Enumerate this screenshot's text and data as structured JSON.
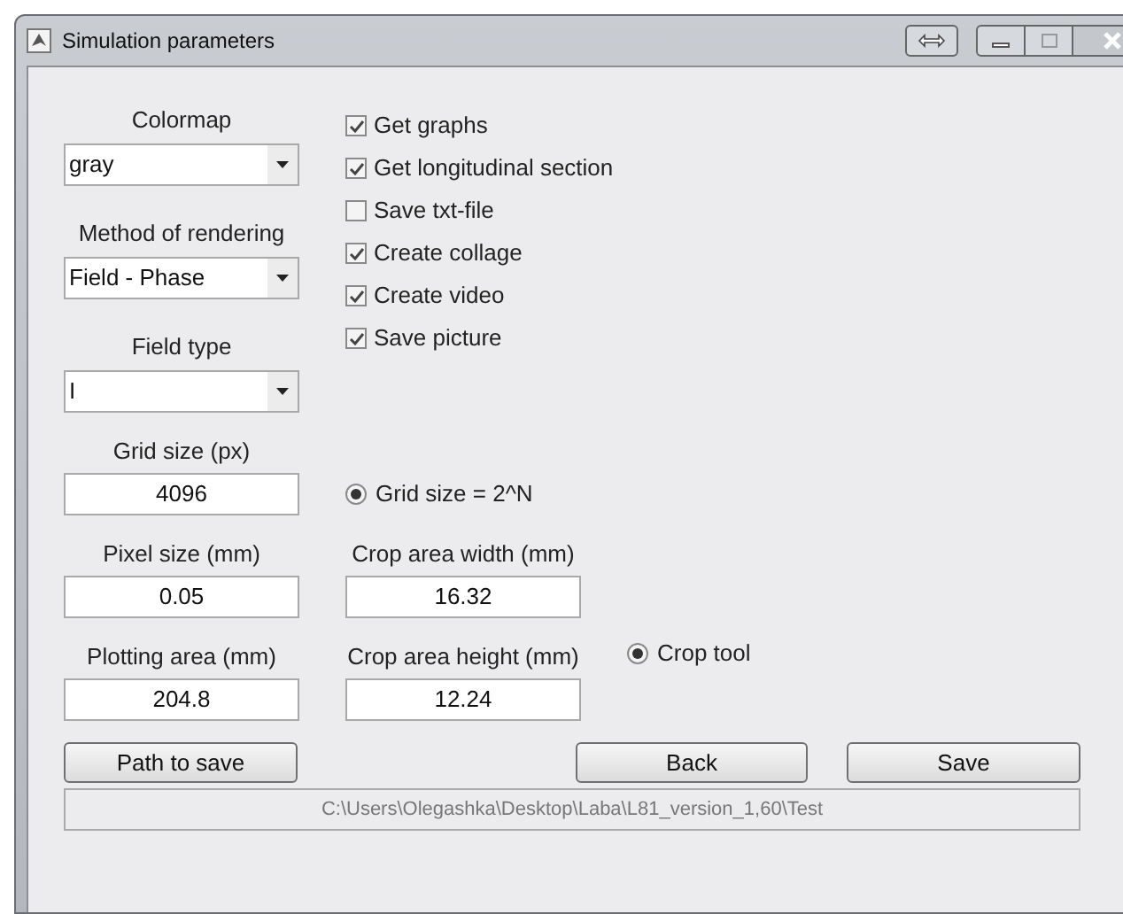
{
  "window": {
    "title": "Simulation parameters"
  },
  "dropdowns": [
    {
      "label": "Colormap",
      "value": "gray"
    },
    {
      "label": "Method of rendering",
      "value": "Field - Phase"
    },
    {
      "label": "Field type",
      "value": "I"
    }
  ],
  "checkboxes": [
    {
      "label": "Get graphs",
      "checked": true
    },
    {
      "label": "Get longitudinal section",
      "checked": true
    },
    {
      "label": "Save txt-file",
      "checked": false
    },
    {
      "label": "Create collage",
      "checked": true
    },
    {
      "label": "Create video",
      "checked": true
    },
    {
      "label": "Save picture",
      "checked": true
    }
  ],
  "grid_size": {
    "label": "Grid size (px)",
    "value": "4096"
  },
  "grid_radio": {
    "label": "Grid size = 2^N",
    "selected": true
  },
  "pixel_size": {
    "label": "Pixel size (mm)",
    "value": "0.05"
  },
  "crop_width": {
    "label": "Crop area width (mm)",
    "value": "16.32"
  },
  "plotting_area": {
    "label": "Plotting area (mm)",
    "value": "204.8"
  },
  "crop_height": {
    "label": "Crop area height (mm)",
    "value": "12.24"
  },
  "crop_radio": {
    "label": "Crop tool",
    "selected": true
  },
  "buttons": {
    "path": "Path to save",
    "back": "Back",
    "save": "Save"
  },
  "path_display": "C:\\Users\\Olegashka\\Desktop\\Laba\\L81_version_1,60\\Test"
}
